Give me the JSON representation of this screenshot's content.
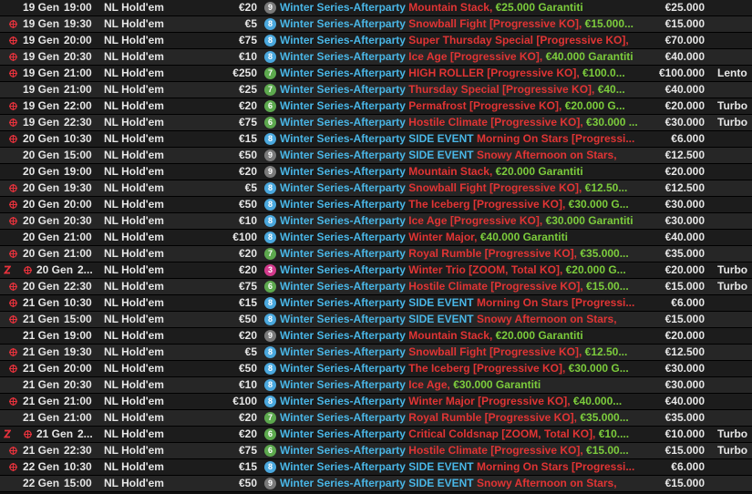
{
  "colors": {
    "series": "#49b6e6",
    "event": "#e03434",
    "guaranteed": "#7ccc3c",
    "badge_gray": "#7a7a7a",
    "badge_blue": "#4aa8de",
    "badge_green": "#5da94e",
    "badge_pink": "#d23a8c",
    "icon": "#e8323c"
  },
  "icons": {
    "registration": "target-icon",
    "zoom": "zoom-z-icon"
  },
  "rows": [
    {
      "zoom": false,
      "reg": false,
      "date": "19 Gen",
      "time": "19:00",
      "game": "NL Hold'em",
      "buyin": "€20",
      "badge": "9",
      "badge_color": "#7a7a7a",
      "series": "Winter Series-Afterparty",
      "side": "",
      "event": "Mountain Stack, ",
      "guaranteed": "€25.000 Garantiti",
      "prize": "€25.000",
      "speed": ""
    },
    {
      "zoom": false,
      "reg": true,
      "date": "19 Gen",
      "time": "19:30",
      "game": "NL Hold'em",
      "buyin": "€5",
      "badge": "8",
      "badge_color": "#4aa8de",
      "series": "Winter Series-Afterparty",
      "side": "",
      "event": "Snowball Fight [Progressive KO], ",
      "guaranteed": "€15.000...",
      "prize": "€15.000",
      "speed": ""
    },
    {
      "zoom": false,
      "reg": true,
      "date": "19 Gen",
      "time": "20:00",
      "game": "NL Hold'em",
      "buyin": "€75",
      "badge": "8",
      "badge_color": "#4aa8de",
      "series": "Winter Series-Afterparty",
      "side": "",
      "event": "Super Thursday Special [Progressive KO],",
      "guaranteed": "",
      "prize": "€70.000",
      "speed": ""
    },
    {
      "zoom": false,
      "reg": true,
      "date": "19 Gen",
      "time": "20:30",
      "game": "NL Hold'em",
      "buyin": "€10",
      "badge": "8",
      "badge_color": "#4aa8de",
      "series": "Winter Series-Afterparty",
      "side": "",
      "event": "Ice Age [Progressive KO], ",
      "guaranteed": "€40.000 Garantiti",
      "prize": "€40.000",
      "speed": ""
    },
    {
      "zoom": false,
      "reg": true,
      "date": "19 Gen",
      "time": "21:00",
      "game": "NL Hold'em",
      "buyin": "€250",
      "badge": "7",
      "badge_color": "#5da94e",
      "series": "Winter Series-Afterparty",
      "side": "",
      "event": "HIGH ROLLER [Progressive KO], ",
      "guaranteed": "€100.0...",
      "prize": "€100.000",
      "speed": "Lento"
    },
    {
      "zoom": false,
      "reg": false,
      "date": "19 Gen",
      "time": "21:00",
      "game": "NL Hold'em",
      "buyin": "€25",
      "badge": "7",
      "badge_color": "#5da94e",
      "series": "Winter Series-Afterparty",
      "side": "",
      "event": "Thursday Special [Progressive KO], ",
      "guaranteed": "€40...",
      "prize": "€40.000",
      "speed": ""
    },
    {
      "zoom": false,
      "reg": true,
      "date": "19 Gen",
      "time": "22:00",
      "game": "NL Hold'em",
      "buyin": "€20",
      "badge": "6",
      "badge_color": "#5da94e",
      "series": "Winter Series-Afterparty",
      "side": "",
      "event": "Permafrost [Progressive KO], ",
      "guaranteed": "€20.000 G...",
      "prize": "€20.000",
      "speed": "Turbo"
    },
    {
      "zoom": false,
      "reg": true,
      "date": "19 Gen",
      "time": "22:30",
      "game": "NL Hold'em",
      "buyin": "€75",
      "badge": "6",
      "badge_color": "#5da94e",
      "series": "Winter Series-Afterparty",
      "side": "",
      "event": "Hostile Climate [Progressive KO], ",
      "guaranteed": "€30.000 ...",
      "prize": "€30.000",
      "speed": "Turbo"
    },
    {
      "zoom": false,
      "reg": true,
      "date": "20 Gen",
      "time": "10:30",
      "game": "NL Hold'em",
      "buyin": "€15",
      "badge": "8",
      "badge_color": "#4aa8de",
      "series": "Winter Series-Afterparty",
      "side": "SIDE EVENT",
      "event": "Morning On Stars [Progressi...",
      "guaranteed": "",
      "prize": "€6.000",
      "speed": ""
    },
    {
      "zoom": false,
      "reg": false,
      "date": "20 Gen",
      "time": "15:00",
      "game": "NL Hold'em",
      "buyin": "€50",
      "badge": "9",
      "badge_color": "#7a7a7a",
      "series": "Winter Series-Afterparty",
      "side": "SIDE EVENT",
      "event": "Snowy Afternoon on Stars,",
      "guaranteed": "",
      "prize": "€12.500",
      "speed": ""
    },
    {
      "zoom": false,
      "reg": false,
      "date": "20 Gen",
      "time": "19:00",
      "game": "NL Hold'em",
      "buyin": "€20",
      "badge": "9",
      "badge_color": "#7a7a7a",
      "series": "Winter Series-Afterparty",
      "side": "",
      "event": "Mountain Stack, ",
      "guaranteed": "€20.000 Garantiti",
      "prize": "€20.000",
      "speed": ""
    },
    {
      "zoom": false,
      "reg": true,
      "date": "20 Gen",
      "time": "19:30",
      "game": "NL Hold'em",
      "buyin": "€5",
      "badge": "8",
      "badge_color": "#4aa8de",
      "series": "Winter Series-Afterparty",
      "side": "",
      "event": "Snowball Fight [Progressive KO], ",
      "guaranteed": "€12.50...",
      "prize": "€12.500",
      "speed": ""
    },
    {
      "zoom": false,
      "reg": true,
      "date": "20 Gen",
      "time": "20:00",
      "game": "NL Hold'em",
      "buyin": "€50",
      "badge": "8",
      "badge_color": "#4aa8de",
      "series": "Winter Series-Afterparty",
      "side": "",
      "event": "The Iceberg [Progressive KO], ",
      "guaranteed": "€30.000 G...",
      "prize": "€30.000",
      "speed": ""
    },
    {
      "zoom": false,
      "reg": true,
      "date": "20 Gen",
      "time": "20:30",
      "game": "NL Hold'em",
      "buyin": "€10",
      "badge": "8",
      "badge_color": "#4aa8de",
      "series": "Winter Series-Afterparty",
      "side": "",
      "event": "Ice Age [Progressive KO], ",
      "guaranteed": "€30.000 Garantiti",
      "prize": "€30.000",
      "speed": ""
    },
    {
      "zoom": false,
      "reg": false,
      "date": "20 Gen",
      "time": "21:00",
      "game": "NL Hold'em",
      "buyin": "€100",
      "badge": "8",
      "badge_color": "#4aa8de",
      "series": "Winter Series-Afterparty",
      "side": "",
      "event": "Winter Major, ",
      "guaranteed": "€40.000 Garantiti",
      "prize": "€40.000",
      "speed": ""
    },
    {
      "zoom": false,
      "reg": true,
      "date": "20 Gen",
      "time": "21:00",
      "game": "NL Hold'em",
      "buyin": "€20",
      "badge": "7",
      "badge_color": "#5da94e",
      "series": "Winter Series-Afterparty",
      "side": "",
      "event": "Royal Rumble [Progressive KO], ",
      "guaranteed": "€35.000...",
      "prize": "€35.000",
      "speed": ""
    },
    {
      "zoom": true,
      "reg": true,
      "date": "20 Gen",
      "time": "2...",
      "game": "NL Hold'em",
      "buyin": "€20",
      "badge": "3",
      "badge_color": "#d23a8c",
      "series": "Winter Series-Afterparty",
      "side": "",
      "event": "Winter Trio [ZOOM, Total KO], ",
      "guaranteed": "€20.000 G...",
      "prize": "€20.000",
      "speed": "Turbo"
    },
    {
      "zoom": false,
      "reg": true,
      "date": "20 Gen",
      "time": "22:30",
      "game": "NL Hold'em",
      "buyin": "€75",
      "badge": "6",
      "badge_color": "#5da94e",
      "series": "Winter Series-Afterparty",
      "side": "",
      "event": "Hostile Climate [Progressive KO], ",
      "guaranteed": "€15.00...",
      "prize": "€15.000",
      "speed": "Turbo"
    },
    {
      "zoom": false,
      "reg": true,
      "date": "21 Gen",
      "time": "10:30",
      "game": "NL Hold'em",
      "buyin": "€15",
      "badge": "8",
      "badge_color": "#4aa8de",
      "series": "Winter Series-Afterparty",
      "side": "SIDE EVENT",
      "event": "Morning On Stars [Progressi...",
      "guaranteed": "",
      "prize": "€6.000",
      "speed": ""
    },
    {
      "zoom": false,
      "reg": true,
      "date": "21 Gen",
      "time": "15:00",
      "game": "NL Hold'em",
      "buyin": "€50",
      "badge": "8",
      "badge_color": "#4aa8de",
      "series": "Winter Series-Afterparty",
      "side": "SIDE EVENT",
      "event": "Snowy Afternoon on Stars,",
      "guaranteed": "",
      "prize": "€15.000",
      "speed": ""
    },
    {
      "zoom": false,
      "reg": false,
      "date": "21 Gen",
      "time": "19:00",
      "game": "NL Hold'em",
      "buyin": "€20",
      "badge": "9",
      "badge_color": "#7a7a7a",
      "series": "Winter Series-Afterparty",
      "side": "",
      "event": "Mountain Stack, ",
      "guaranteed": "€20.000 Garantiti",
      "prize": "€20.000",
      "speed": ""
    },
    {
      "zoom": false,
      "reg": true,
      "date": "21 Gen",
      "time": "19:30",
      "game": "NL Hold'em",
      "buyin": "€5",
      "badge": "8",
      "badge_color": "#4aa8de",
      "series": "Winter Series-Afterparty",
      "side": "",
      "event": "Snowball Fight [Progressive KO], ",
      "guaranteed": "€12.50...",
      "prize": "€12.500",
      "speed": ""
    },
    {
      "zoom": false,
      "reg": true,
      "date": "21 Gen",
      "time": "20:00",
      "game": "NL Hold'em",
      "buyin": "€50",
      "badge": "8",
      "badge_color": "#4aa8de",
      "series": "Winter Series-Afterparty",
      "side": "",
      "event": "The Iceberg [Progressive KO], ",
      "guaranteed": "€30.000 G...",
      "prize": "€30.000",
      "speed": ""
    },
    {
      "zoom": false,
      "reg": false,
      "date": "21 Gen",
      "time": "20:30",
      "game": "NL Hold'em",
      "buyin": "€10",
      "badge": "8",
      "badge_color": "#4aa8de",
      "series": "Winter Series-Afterparty",
      "side": "",
      "event": "Ice Age, ",
      "guaranteed": "€30.000 Garantiti",
      "prize": "€30.000",
      "speed": ""
    },
    {
      "zoom": false,
      "reg": true,
      "date": "21 Gen",
      "time": "21:00",
      "game": "NL Hold'em",
      "buyin": "€100",
      "badge": "8",
      "badge_color": "#4aa8de",
      "series": "Winter Series-Afterparty",
      "side": "",
      "event": "Winter Major [Progressive KO], ",
      "guaranteed": "€40.000...",
      "prize": "€40.000",
      "speed": ""
    },
    {
      "zoom": false,
      "reg": false,
      "date": "21 Gen",
      "time": "21:00",
      "game": "NL Hold'em",
      "buyin": "€20",
      "badge": "7",
      "badge_color": "#5da94e",
      "series": "Winter Series-Afterparty",
      "side": "",
      "event": "Royal Rumble [Progressive KO], ",
      "guaranteed": "€35.000...",
      "prize": "€35.000",
      "speed": ""
    },
    {
      "zoom": true,
      "reg": true,
      "date": "21 Gen",
      "time": "2...",
      "game": "NL Hold'em",
      "buyin": "€20",
      "badge": "6",
      "badge_color": "#5da94e",
      "series": "Winter Series-Afterparty",
      "side": "",
      "event": "Critical Coldsnap [ZOOM, Total KO], ",
      "guaranteed": "€10....",
      "prize": "€10.000",
      "speed": "Turbo"
    },
    {
      "zoom": false,
      "reg": true,
      "date": "21 Gen",
      "time": "22:30",
      "game": "NL Hold'em",
      "buyin": "€75",
      "badge": "6",
      "badge_color": "#5da94e",
      "series": "Winter Series-Afterparty",
      "side": "",
      "event": "Hostile Climate [Progressive KO], ",
      "guaranteed": "€15.00...",
      "prize": "€15.000",
      "speed": "Turbo"
    },
    {
      "zoom": false,
      "reg": true,
      "date": "22 Gen",
      "time": "10:30",
      "game": "NL Hold'em",
      "buyin": "€15",
      "badge": "8",
      "badge_color": "#4aa8de",
      "series": "Winter Series-Afterparty",
      "side": "SIDE EVENT",
      "event": "Morning On Stars [Progressi...",
      "guaranteed": "",
      "prize": "€6.000",
      "speed": ""
    },
    {
      "zoom": false,
      "reg": false,
      "date": "22 Gen",
      "time": "15:00",
      "game": "NL Hold'em",
      "buyin": "€50",
      "badge": "9",
      "badge_color": "#7a7a7a",
      "series": "Winter Series-Afterparty",
      "side": "SIDE EVENT",
      "event": "Snowy Afternoon on Stars,",
      "guaranteed": "",
      "prize": "€15.000",
      "speed": ""
    }
  ]
}
